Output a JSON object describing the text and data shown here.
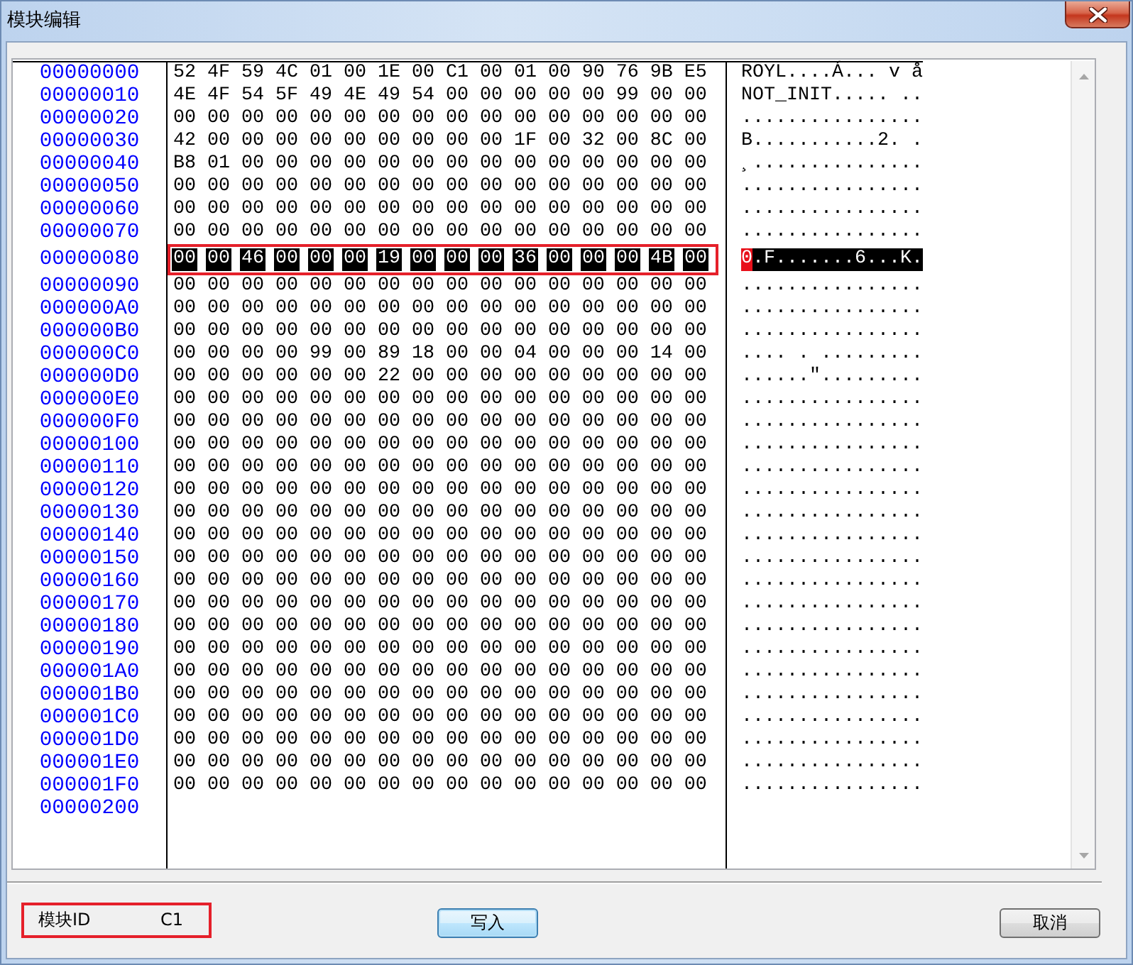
{
  "window": {
    "title": "模块编辑"
  },
  "hex_view": {
    "rows": [
      {
        "address": "00000000",
        "hex": "52 4F 59 4C 01 00 1E 00 C1 00 01 00 90 76 9B E5",
        "ascii": "ROYL....Á... v å",
        "selected": false,
        "annotated": false
      },
      {
        "address": "00000010",
        "hex": "4E 4F 54 5F 49 4E 49 54 00 00 00 00 00 99 00 00",
        "ascii": "NOT_INIT..... ..",
        "selected": false,
        "annotated": false
      },
      {
        "address": "00000020",
        "hex": "00 00 00 00 00 00 00 00 00 00 00 00 00 00 00 00",
        "ascii": "................",
        "selected": false,
        "annotated": false
      },
      {
        "address": "00000030",
        "hex": "42 00 00 00 00 00 00 00 00 00 1F 00 32 00 8C 00",
        "ascii": "B...........2. .",
        "selected": false,
        "annotated": false
      },
      {
        "address": "00000040",
        "hex": "B8 01 00 00 00 00 00 00 00 00 00 00 00 00 00 00",
        "ascii": "¸...............",
        "selected": false,
        "annotated": false
      },
      {
        "address": "00000050",
        "hex": "00 00 00 00 00 00 00 00 00 00 00 00 00 00 00 00",
        "ascii": "................",
        "selected": false,
        "annotated": false
      },
      {
        "address": "00000060",
        "hex": "00 00 00 00 00 00 00 00 00 00 00 00 00 00 00 00",
        "ascii": "................",
        "selected": false,
        "annotated": false
      },
      {
        "address": "00000070",
        "hex": "00 00 00 00 00 00 00 00 00 00 00 00 00 00 00 00",
        "ascii": "................",
        "selected": false,
        "annotated": false
      },
      {
        "address": "00000080",
        "hex": "00 00 46 00 00 00 19 00 00 00 36 00 00 00 4B 00",
        "cursor": "0",
        "ascii": ".F.......6...K.",
        "selected": true,
        "annotated": true
      },
      {
        "address": "00000090",
        "hex": "00 00 00 00 00 00 00 00 00 00 00 00 00 00 00 00",
        "ascii": "................",
        "selected": false,
        "annotated": false
      },
      {
        "address": "000000A0",
        "hex": "00 00 00 00 00 00 00 00 00 00 00 00 00 00 00 00",
        "ascii": "................",
        "selected": false,
        "annotated": false
      },
      {
        "address": "000000B0",
        "hex": "00 00 00 00 00 00 00 00 00 00 00 00 00 00 00 00",
        "ascii": "................",
        "selected": false,
        "annotated": false
      },
      {
        "address": "000000C0",
        "hex": "00 00 00 00 99 00 89 18 00 00 04 00 00 00 14 00",
        "ascii": ".... . .........",
        "selected": false,
        "annotated": false
      },
      {
        "address": "000000D0",
        "hex": "00 00 00 00 00 00 22 00 00 00 00 00 00 00 00 00",
        "ascii": "......\".........",
        "selected": false,
        "annotated": false
      },
      {
        "address": "000000E0",
        "hex": "00 00 00 00 00 00 00 00 00 00 00 00 00 00 00 00",
        "ascii": "................",
        "selected": false,
        "annotated": false
      },
      {
        "address": "000000F0",
        "hex": "00 00 00 00 00 00 00 00 00 00 00 00 00 00 00 00",
        "ascii": "................",
        "selected": false,
        "annotated": false
      },
      {
        "address": "00000100",
        "hex": "00 00 00 00 00 00 00 00 00 00 00 00 00 00 00 00",
        "ascii": "................",
        "selected": false,
        "annotated": false
      },
      {
        "address": "00000110",
        "hex": "00 00 00 00 00 00 00 00 00 00 00 00 00 00 00 00",
        "ascii": "................",
        "selected": false,
        "annotated": false
      },
      {
        "address": "00000120",
        "hex": "00 00 00 00 00 00 00 00 00 00 00 00 00 00 00 00",
        "ascii": "................",
        "selected": false,
        "annotated": false
      },
      {
        "address": "00000130",
        "hex": "00 00 00 00 00 00 00 00 00 00 00 00 00 00 00 00",
        "ascii": "................",
        "selected": false,
        "annotated": false
      },
      {
        "address": "00000140",
        "hex": "00 00 00 00 00 00 00 00 00 00 00 00 00 00 00 00",
        "ascii": "................",
        "selected": false,
        "annotated": false
      },
      {
        "address": "00000150",
        "hex": "00 00 00 00 00 00 00 00 00 00 00 00 00 00 00 00",
        "ascii": "................",
        "selected": false,
        "annotated": false
      },
      {
        "address": "00000160",
        "hex": "00 00 00 00 00 00 00 00 00 00 00 00 00 00 00 00",
        "ascii": "................",
        "selected": false,
        "annotated": false
      },
      {
        "address": "00000170",
        "hex": "00 00 00 00 00 00 00 00 00 00 00 00 00 00 00 00",
        "ascii": "................",
        "selected": false,
        "annotated": false
      },
      {
        "address": "00000180",
        "hex": "00 00 00 00 00 00 00 00 00 00 00 00 00 00 00 00",
        "ascii": "................",
        "selected": false,
        "annotated": false
      },
      {
        "address": "00000190",
        "hex": "00 00 00 00 00 00 00 00 00 00 00 00 00 00 00 00",
        "ascii": "................",
        "selected": false,
        "annotated": false
      },
      {
        "address": "000001A0",
        "hex": "00 00 00 00 00 00 00 00 00 00 00 00 00 00 00 00",
        "ascii": "................",
        "selected": false,
        "annotated": false
      },
      {
        "address": "000001B0",
        "hex": "00 00 00 00 00 00 00 00 00 00 00 00 00 00 00 00",
        "ascii": "................",
        "selected": false,
        "annotated": false
      },
      {
        "address": "000001C0",
        "hex": "00 00 00 00 00 00 00 00 00 00 00 00 00 00 00 00",
        "ascii": "................",
        "selected": false,
        "annotated": false
      },
      {
        "address": "000001D0",
        "hex": "00 00 00 00 00 00 00 00 00 00 00 00 00 00 00 00",
        "ascii": "................",
        "selected": false,
        "annotated": false
      },
      {
        "address": "000001E0",
        "hex": "00 00 00 00 00 00 00 00 00 00 00 00 00 00 00 00",
        "ascii": "................",
        "selected": false,
        "annotated": false
      },
      {
        "address": "000001F0",
        "hex": "00 00 00 00 00 00 00 00 00 00 00 00 00 00 00 00",
        "ascii": "................",
        "selected": false,
        "annotated": false
      }
    ],
    "end_address": "00000200"
  },
  "module_id": {
    "label": "模块ID",
    "value": "C1",
    "annotated": true
  },
  "buttons": [
    {
      "label": "写入",
      "default": true
    },
    {
      "label": "取消",
      "default": false
    }
  ]
}
